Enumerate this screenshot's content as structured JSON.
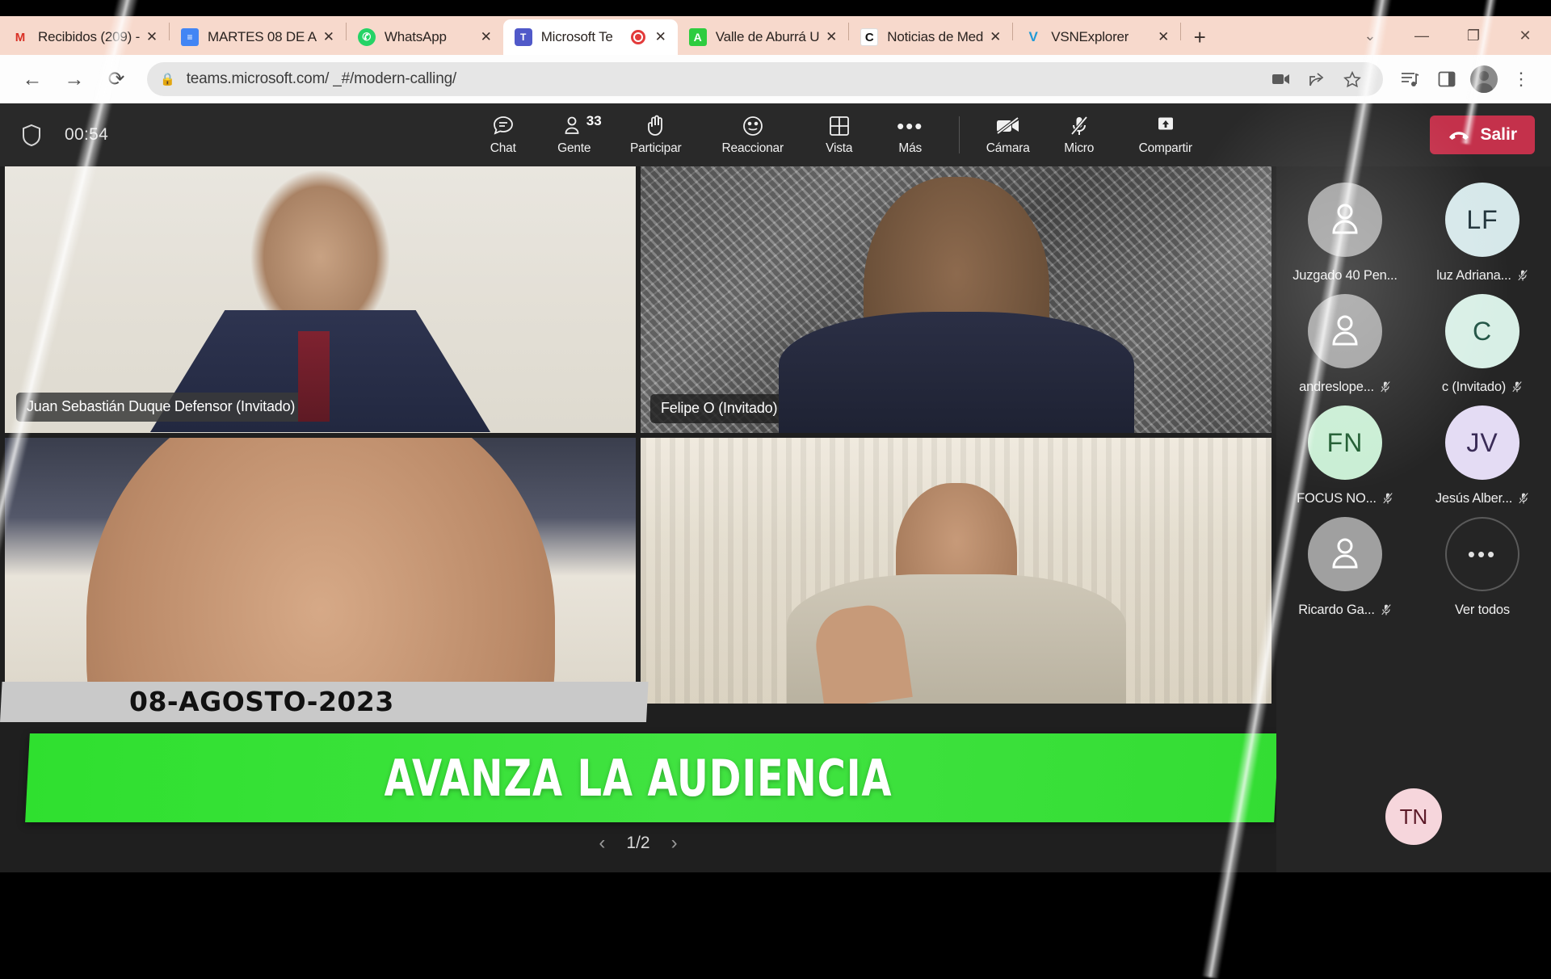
{
  "browser": {
    "tabs": [
      {
        "title": "Recibidos (209) -",
        "icon": "gmail-icon",
        "active": false,
        "recording": false
      },
      {
        "title": "MARTES 08 DE A",
        "icon": "google-docs-icon",
        "active": false,
        "recording": false
      },
      {
        "title": "WhatsApp",
        "icon": "whatsapp-icon",
        "active": false,
        "recording": false
      },
      {
        "title": "Microsoft Te",
        "icon": "microsoft-teams-icon",
        "active": true,
        "recording": true
      },
      {
        "title": "Valle de Aburrá U",
        "icon": "green-a-icon",
        "active": false,
        "recording": false
      },
      {
        "title": "Noticias de Med",
        "icon": "c-letter-icon",
        "active": false,
        "recording": false
      },
      {
        "title": "VSNExplorer",
        "icon": "vsn-icon",
        "active": false,
        "recording": false
      }
    ],
    "new_tab_label": "+",
    "window_controls": [
      "tab-search-chevron",
      "minimize",
      "maximize",
      "close"
    ],
    "back_label": "←",
    "forward_label": "→",
    "reload_label": "⟳",
    "url": "teams.microsoft.com/ _#/modern-calling/",
    "lock_icon": "lock-icon",
    "toolbar_icons": [
      "video-camera-icon",
      "share-icon",
      "bookmark-star-icon",
      "reading-list-icon",
      "side-panel-icon",
      "profile-avatar-icon",
      "three-dot-menu-icon"
    ]
  },
  "teams": {
    "shield_icon": "shield-icon",
    "timer": "00:54",
    "actions": [
      {
        "label": "Chat",
        "icon": "chat-bubble-icon",
        "badge": ""
      },
      {
        "label": "Gente",
        "icon": "people-icon",
        "badge": "33"
      },
      {
        "label": "Participar",
        "icon": "raise-hand-icon",
        "badge": ""
      },
      {
        "label": "Reaccionar",
        "icon": "smiley-icon",
        "badge": ""
      },
      {
        "label": "Vista",
        "icon": "grid-view-icon",
        "badge": ""
      },
      {
        "label": "Más",
        "icon": "more-ellipsis-icon",
        "badge": ""
      }
    ],
    "device_controls": [
      {
        "label": "Cámara",
        "icon": "camera-off-icon",
        "state": "off"
      },
      {
        "label": "Micro",
        "icon": "mic-off-icon",
        "state": "off"
      },
      {
        "label": "Compartir",
        "icon": "share-screen-icon",
        "state": "on"
      }
    ],
    "leave_label": "Salir",
    "leave_icon": "hangup-phone-icon",
    "leave_color": "#c4314b",
    "pager": {
      "prev": "‹",
      "current": "1/2",
      "next": "›"
    },
    "tiles": [
      {
        "name": "Juan Sebastián Duque Defensor (Invitado)",
        "speaking": true,
        "muted": false
      },
      {
        "name": "Felipe O (Invitado)",
        "speaking": false,
        "muted": true
      },
      {
        "name": "",
        "speaking": false,
        "muted": false
      },
      {
        "name": "",
        "speaking": false,
        "muted": false
      }
    ],
    "roster": [
      {
        "name": "Juzgado 40 Pen...",
        "initials": "",
        "avatar_type": "generic",
        "avatar_color": "#a0a0a0",
        "muted": false
      },
      {
        "name": "luz Adriana...",
        "initials": "LF",
        "avatar_type": "initials",
        "avatar_color": "#d6e8ea",
        "muted": true
      },
      {
        "name": "andreslope...",
        "initials": "",
        "avatar_type": "generic",
        "avatar_color": "#a0a0a0",
        "muted": true
      },
      {
        "name": "c (Invitado)",
        "initials": "C",
        "avatar_type": "initials",
        "avatar_color": "#d8efe6",
        "muted": true
      },
      {
        "name": "FOCUS NO...",
        "initials": "FN",
        "avatar_type": "initials",
        "avatar_color": "#c9eed4",
        "muted": true
      },
      {
        "name": "Jesús Alber...",
        "initials": "JV",
        "avatar_type": "initials",
        "avatar_color": "#e4dcf4",
        "muted": true
      },
      {
        "name": "Ricardo Ga...",
        "initials": "",
        "avatar_type": "generic",
        "avatar_color": "#a0a0a0",
        "muted": true
      },
      {
        "name": "Ver todos",
        "initials": "•••",
        "avatar_type": "viewall",
        "avatar_color": "#252525",
        "muted": false
      }
    ],
    "self_avatar_initials": "TN",
    "self_avatar_color": "#f6d6dc"
  },
  "broadcast_overlay": {
    "date": "08-AGOSTO-2023",
    "headline": "AVANZA LA AUDIENCIA",
    "banner_color": "#3ae03a",
    "date_bar_color": "#c9c9c9"
  }
}
